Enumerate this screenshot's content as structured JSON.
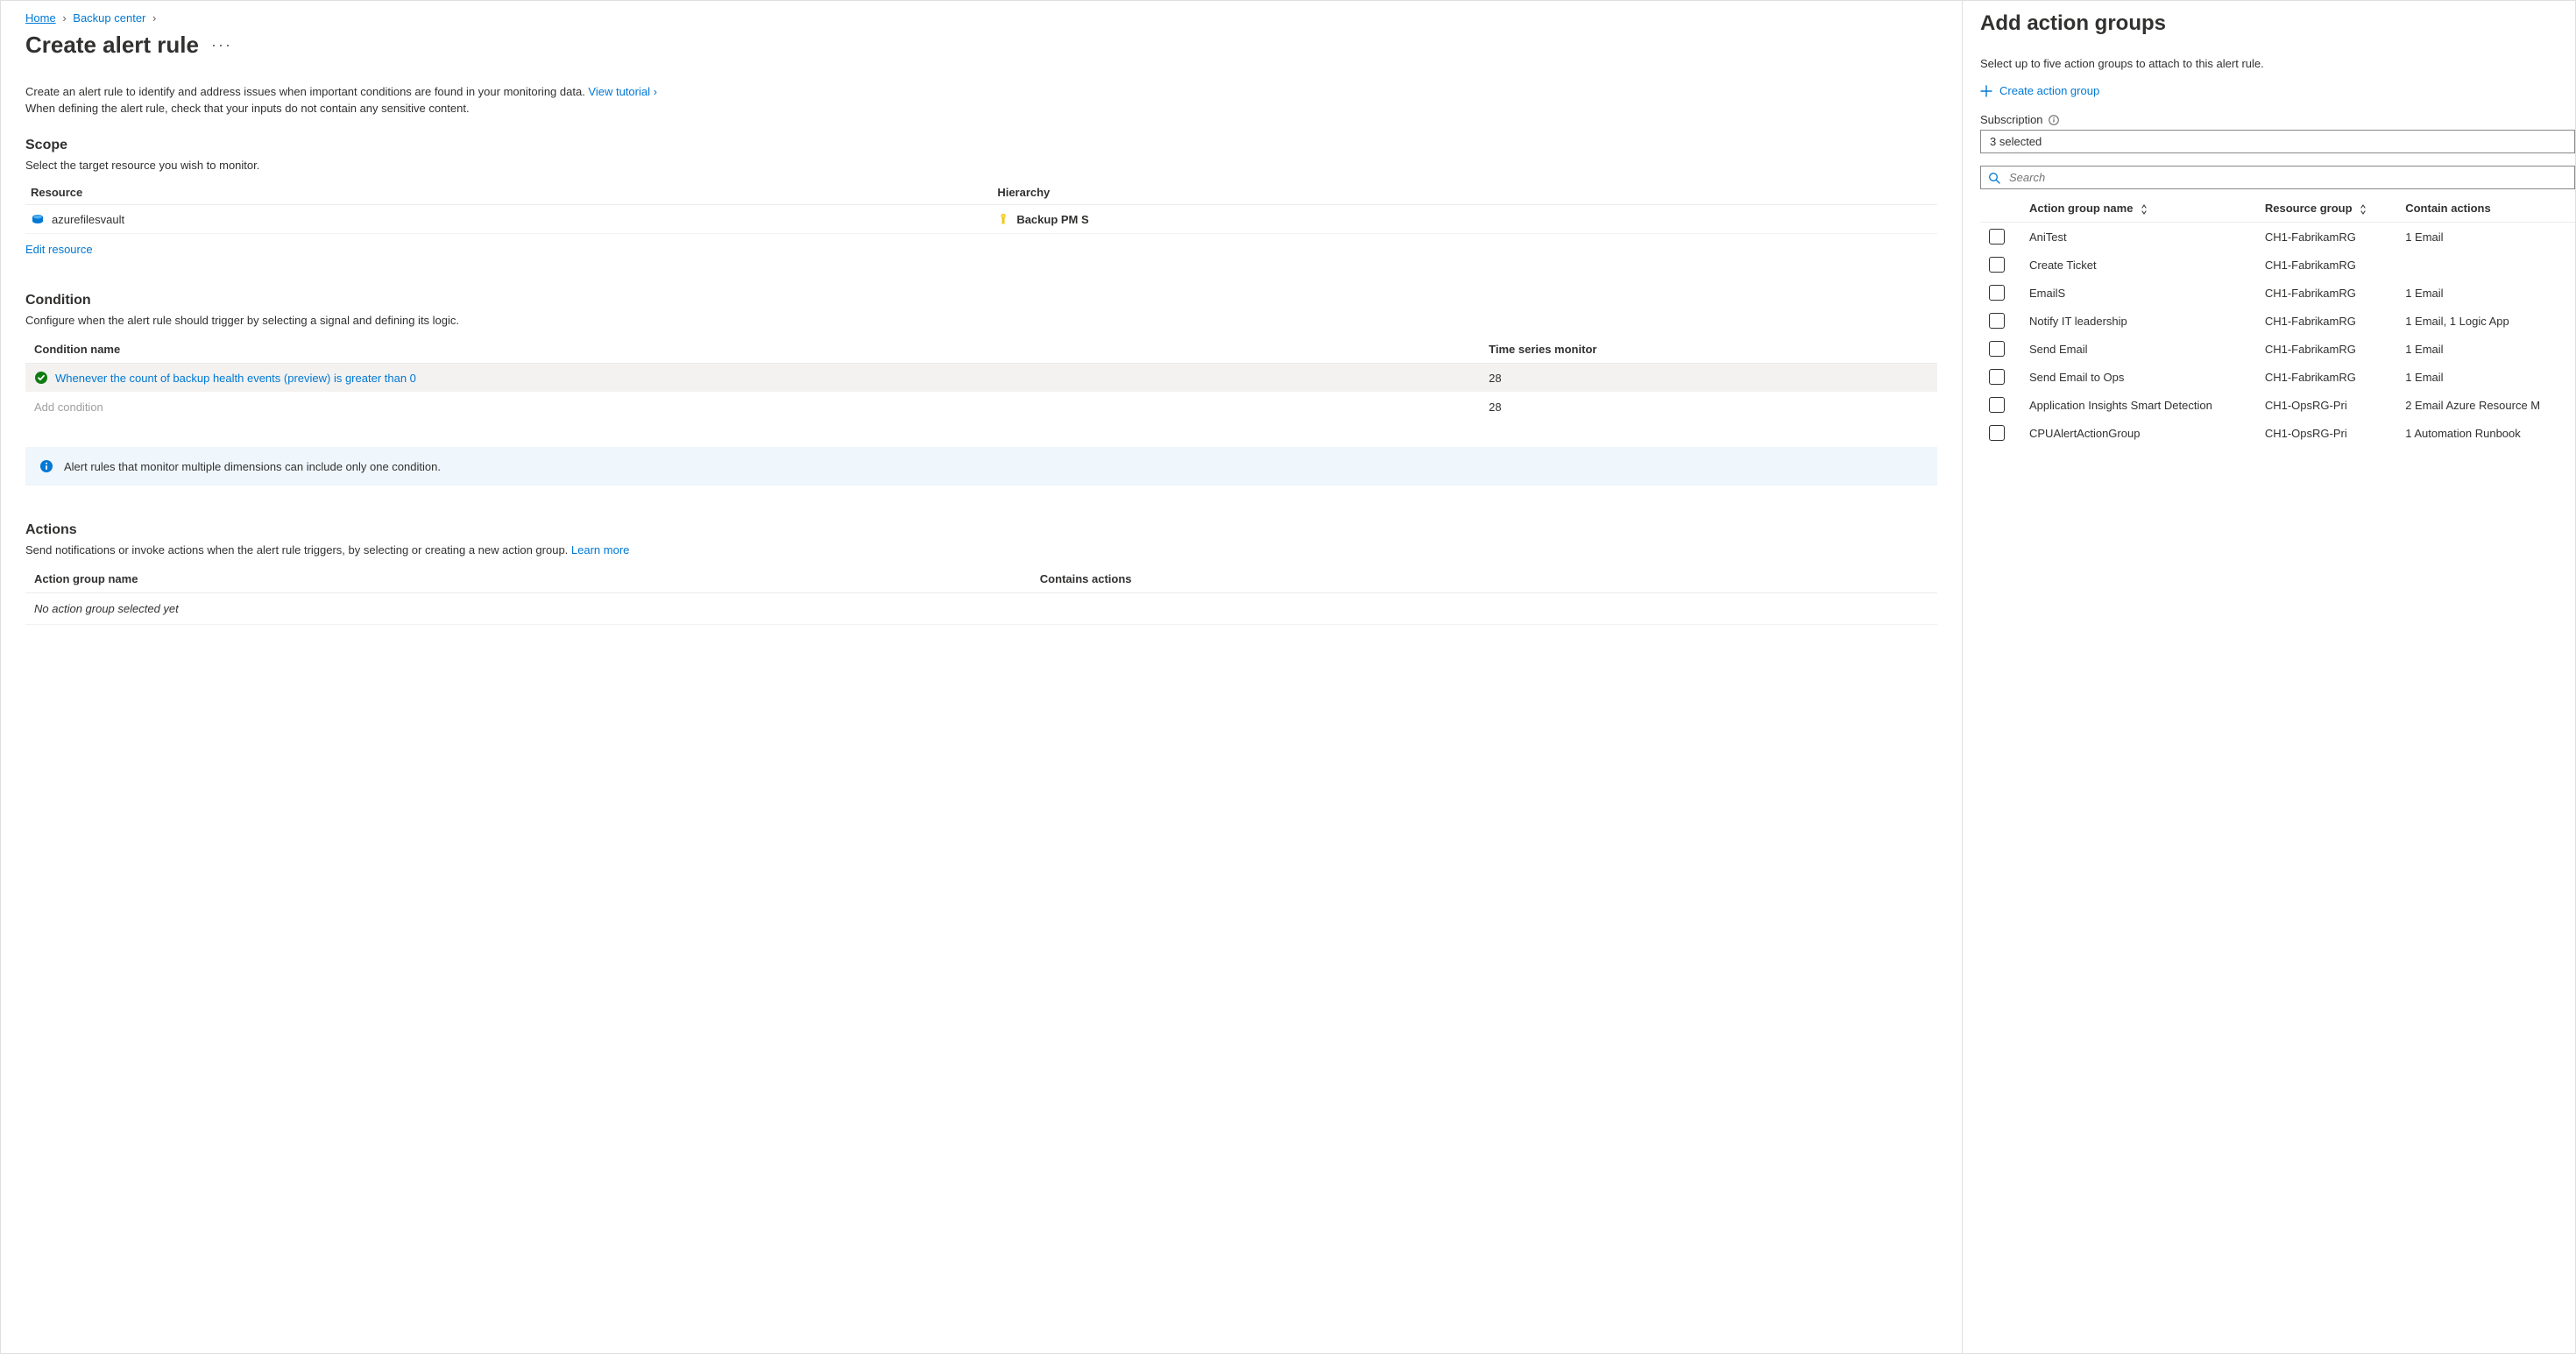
{
  "breadcrumb": {
    "home": "Home",
    "backup_center": "Backup center"
  },
  "page": {
    "title": "Create alert rule",
    "intro_line1_pre": "Create an alert rule to identify and address issues when important conditions are found in your monitoring data. ",
    "intro_link": "View tutorial ›",
    "intro_line2": "When defining the alert rule, check that your inputs do not contain any sensitive content."
  },
  "scope": {
    "heading": "Scope",
    "sub": "Select the target resource you wish to monitor.",
    "col_resource": "Resource",
    "col_hierarchy": "Hierarchy",
    "resource_name": "azurefilesvault",
    "hierarchy_label": "Backup PM S",
    "edit_link": "Edit resource"
  },
  "condition": {
    "heading": "Condition",
    "sub": "Configure when the alert rule should trigger by selecting a signal and defining its logic.",
    "col_name": "Condition name",
    "col_ts": "Time series monitor",
    "row_name": "Whenever the count of backup health events (preview) is greater than 0",
    "row_ts": "28",
    "add_label": "Add condition",
    "add_ts": "28"
  },
  "banner": {
    "text": "Alert rules that monitor multiple dimensions can include only one condition."
  },
  "actions": {
    "heading": "Actions",
    "sub_pre": "Send notifications or invoke actions when the alert rule triggers, by selecting or creating a new action group. ",
    "sub_link": "Learn more",
    "col_name": "Action group name",
    "col_contains": "Contains actions",
    "empty": "No action group selected yet"
  },
  "panel": {
    "title": "Add action groups",
    "sub": "Select up to five action groups to attach to this alert rule.",
    "create_label": "Create action group",
    "subscription_label": "Subscription",
    "subscription_value": "3 selected",
    "search_placeholder": "Search",
    "col_name": "Action group name",
    "col_rg": "Resource group",
    "col_actions": "Contain actions",
    "rows": [
      {
        "name": "AniTest",
        "rg": "CH1-FabrikamRG",
        "actions": "1 Email"
      },
      {
        "name": "Create Ticket",
        "rg": "CH1-FabrikamRG",
        "actions": ""
      },
      {
        "name": "EmailS",
        "rg": "CH1-FabrikamRG",
        "actions": "1 Email"
      },
      {
        "name": "Notify IT leadership",
        "rg": "CH1-FabrikamRG",
        "actions": "1 Email, 1 Logic App"
      },
      {
        "name": "Send Email",
        "rg": "CH1-FabrikamRG",
        "actions": "1 Email"
      },
      {
        "name": "Send Email to Ops",
        "rg": "CH1-FabrikamRG",
        "actions": "1 Email"
      },
      {
        "name": "Application Insights Smart Detection",
        "rg": "CH1-OpsRG-Pri",
        "actions": "2 Email Azure Resource M"
      },
      {
        "name": "CPUAlertActionGroup",
        "rg": "CH1-OpsRG-Pri",
        "actions": "1 Automation Runbook"
      }
    ]
  }
}
